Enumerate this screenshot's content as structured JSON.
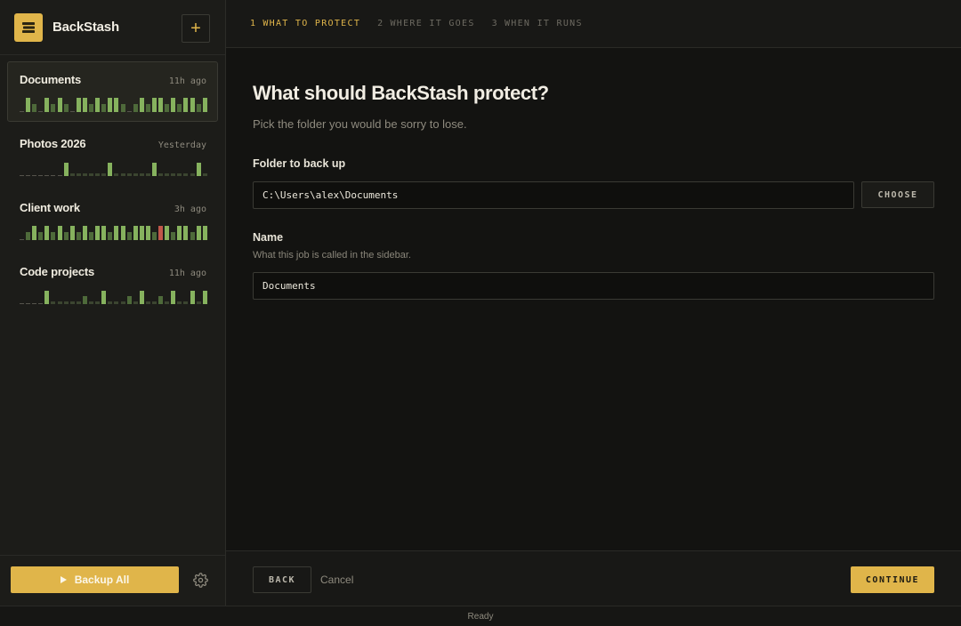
{
  "app": {
    "title": "BackStash"
  },
  "sidebar": {
    "add_label": "+",
    "jobs": [
      {
        "name": "Documents",
        "time": "11h ago",
        "active": true,
        "history": [
          "e",
          "f",
          "s",
          "e",
          "f",
          "s",
          "f",
          "s",
          "e",
          "f",
          "f",
          "s",
          "f",
          "s",
          "f",
          "f",
          "s",
          "e",
          "s",
          "f",
          "s",
          "f",
          "f",
          "s",
          "f",
          "s",
          "f",
          "f",
          "s",
          "f"
        ]
      },
      {
        "name": "Photos 2026",
        "time": "Yesterday",
        "active": false,
        "history": [
          "e",
          "e",
          "e",
          "e",
          "e",
          "e",
          "e",
          "p",
          "d",
          "d",
          "d",
          "d",
          "d",
          "d",
          "p",
          "d",
          "d",
          "d",
          "d",
          "d",
          "d",
          "p",
          "d",
          "d",
          "d",
          "d",
          "d",
          "d",
          "p",
          "d"
        ]
      },
      {
        "name": "Client work",
        "time": "3h ago",
        "active": false,
        "history": [
          "e",
          "s",
          "f",
          "s",
          "f",
          "s",
          "f",
          "s",
          "f",
          "s",
          "f",
          "s",
          "f",
          "f",
          "s",
          "f",
          "f",
          "s",
          "f",
          "f",
          "f",
          "s",
          "x",
          "f",
          "s",
          "f",
          "f",
          "s",
          "f",
          "f"
        ]
      },
      {
        "name": "Code projects",
        "time": "11h ago",
        "active": false,
        "history": [
          "e",
          "e",
          "e",
          "e",
          "p",
          "d",
          "d",
          "d",
          "d",
          "d",
          "s",
          "d",
          "d",
          "p",
          "d",
          "d",
          "d",
          "s",
          "d",
          "p",
          "d",
          "d",
          "s",
          "d",
          "p",
          "d",
          "d",
          "p",
          "d",
          "p"
        ]
      }
    ],
    "backup_all_label": "Backup All"
  },
  "wizard": {
    "steps": [
      {
        "num": "1",
        "label": "WHAT TO PROTECT",
        "active": true
      },
      {
        "num": "2",
        "label": "WHERE IT GOES",
        "active": false
      },
      {
        "num": "3",
        "label": "WHEN IT RUNS",
        "active": false
      }
    ],
    "title": "What should BackStash protect?",
    "subtitle": "Pick the folder you would be sorry to lose.",
    "folder": {
      "label": "Folder to back up",
      "value": "C:\\Users\\alex\\Documents",
      "choose_label": "CHOOSE"
    },
    "name": {
      "label": "Name",
      "hint": "What this job is called in the sidebar.",
      "value": "Documents"
    },
    "back_label": "BACK",
    "cancel_label": "Cancel",
    "continue_label": "CONTINUE"
  },
  "status": {
    "text": "Ready"
  },
  "colors": {
    "accent": "#e0b54a",
    "success": "#86b25e",
    "success_dim": "#4e6a3a",
    "failure": "#c0574a"
  }
}
